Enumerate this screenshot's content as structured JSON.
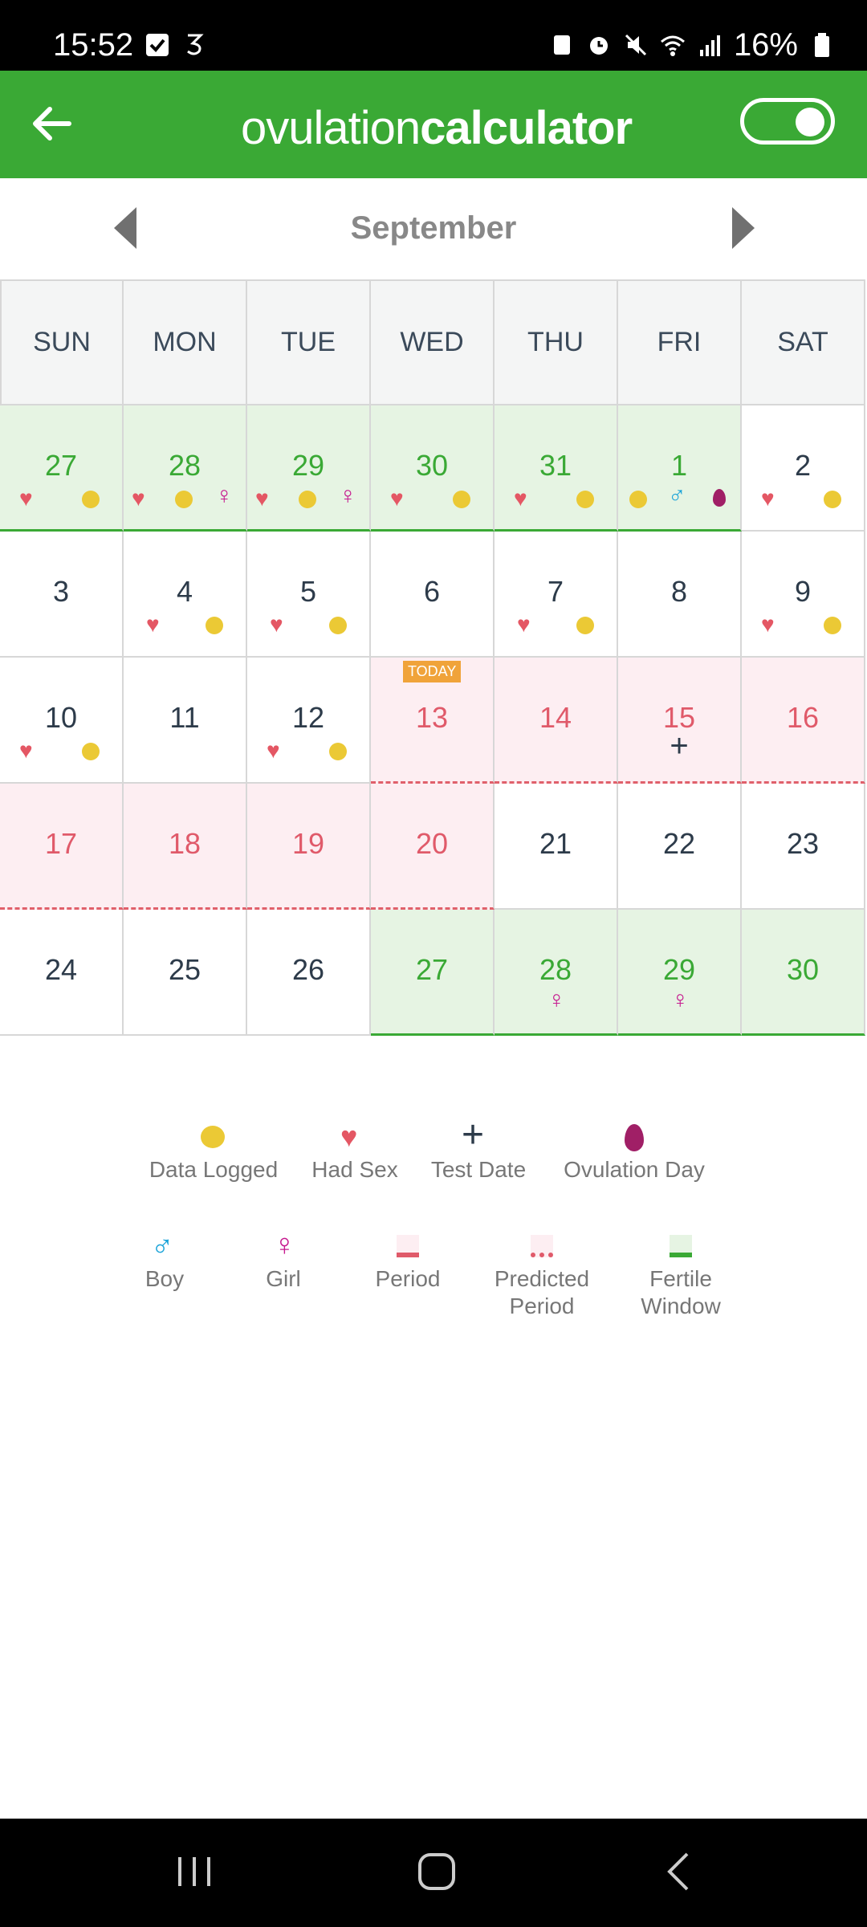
{
  "status_bar": {
    "time": "15:52",
    "battery": "16%",
    "icons": [
      "check-icon",
      "carrier-3-icon",
      "sd-card-icon",
      "alarm-icon",
      "mute-icon",
      "wifi-icon",
      "signal-icon",
      "battery-icon"
    ]
  },
  "header": {
    "logo_part1": "ovulation",
    "logo_part2": "calculator",
    "back_icon": "arrow-left-icon",
    "toggle_state": "on"
  },
  "calendar": {
    "month": "September",
    "days_of_week": [
      "SUN",
      "MON",
      "TUE",
      "WED",
      "THU",
      "FRI",
      "SAT"
    ],
    "today_badge": "TODAY",
    "weeks": [
      [
        "27",
        "28",
        "29",
        "30",
        "31",
        "1",
        "2"
      ],
      [
        "3",
        "4",
        "5",
        "6",
        "7",
        "8",
        "9"
      ],
      [
        "10",
        "11",
        "12",
        "13",
        "14",
        "15",
        "16"
      ],
      [
        "17",
        "18",
        "19",
        "20",
        "21",
        "22",
        "23"
      ],
      [
        "24",
        "25",
        "26",
        "27",
        "28",
        "29",
        "30"
      ]
    ]
  },
  "legend": {
    "data_logged": "Data Logged",
    "had_sex": "Had Sex",
    "test_date": "Test Date",
    "ovulation_day": "Ovulation Day",
    "boy": "Boy",
    "girl": "Girl",
    "period": "Period",
    "predicted_period_1": "Predicted",
    "predicted_period_2": "Period",
    "fertile_window_1": "Fertile",
    "fertile_window_2": "Window"
  },
  "colors": {
    "brand_green": "#3aa935",
    "period_red": "#e05a6a",
    "data_yellow": "#ebc935",
    "girl_magenta": "#c6198f",
    "boy_blue": "#1aa3d8",
    "ovulation_purple": "#a01f66"
  }
}
